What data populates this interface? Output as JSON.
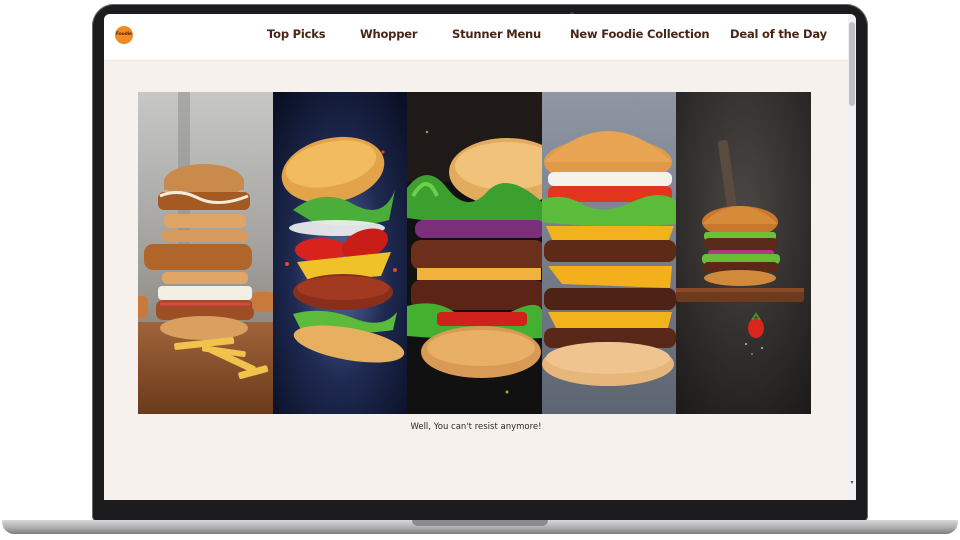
{
  "brand": {
    "logo_text": "Foodie"
  },
  "nav": {
    "items": [
      {
        "label": "Top Picks"
      },
      {
        "label": "Whopper"
      },
      {
        "label": "Stunner Menu"
      },
      {
        "label": "New Foodie Collection"
      },
      {
        "label": "Deal of the Day"
      }
    ]
  },
  "gallery": {
    "panels": [
      {
        "icon": "stacked-burger-with-fries"
      },
      {
        "icon": "floating-burger-ingredients"
      },
      {
        "icon": "lettuce-double-patty-burger"
      },
      {
        "icon": "cheese-triple-patty-burger"
      },
      {
        "icon": "skewered-burger-on-board"
      }
    ]
  },
  "caption": "Well, You can't resist anymore!",
  "colors": {
    "accent_orange": "#f08a24",
    "nav_text": "#4a2414",
    "page_bg": "#f6f1ec"
  }
}
